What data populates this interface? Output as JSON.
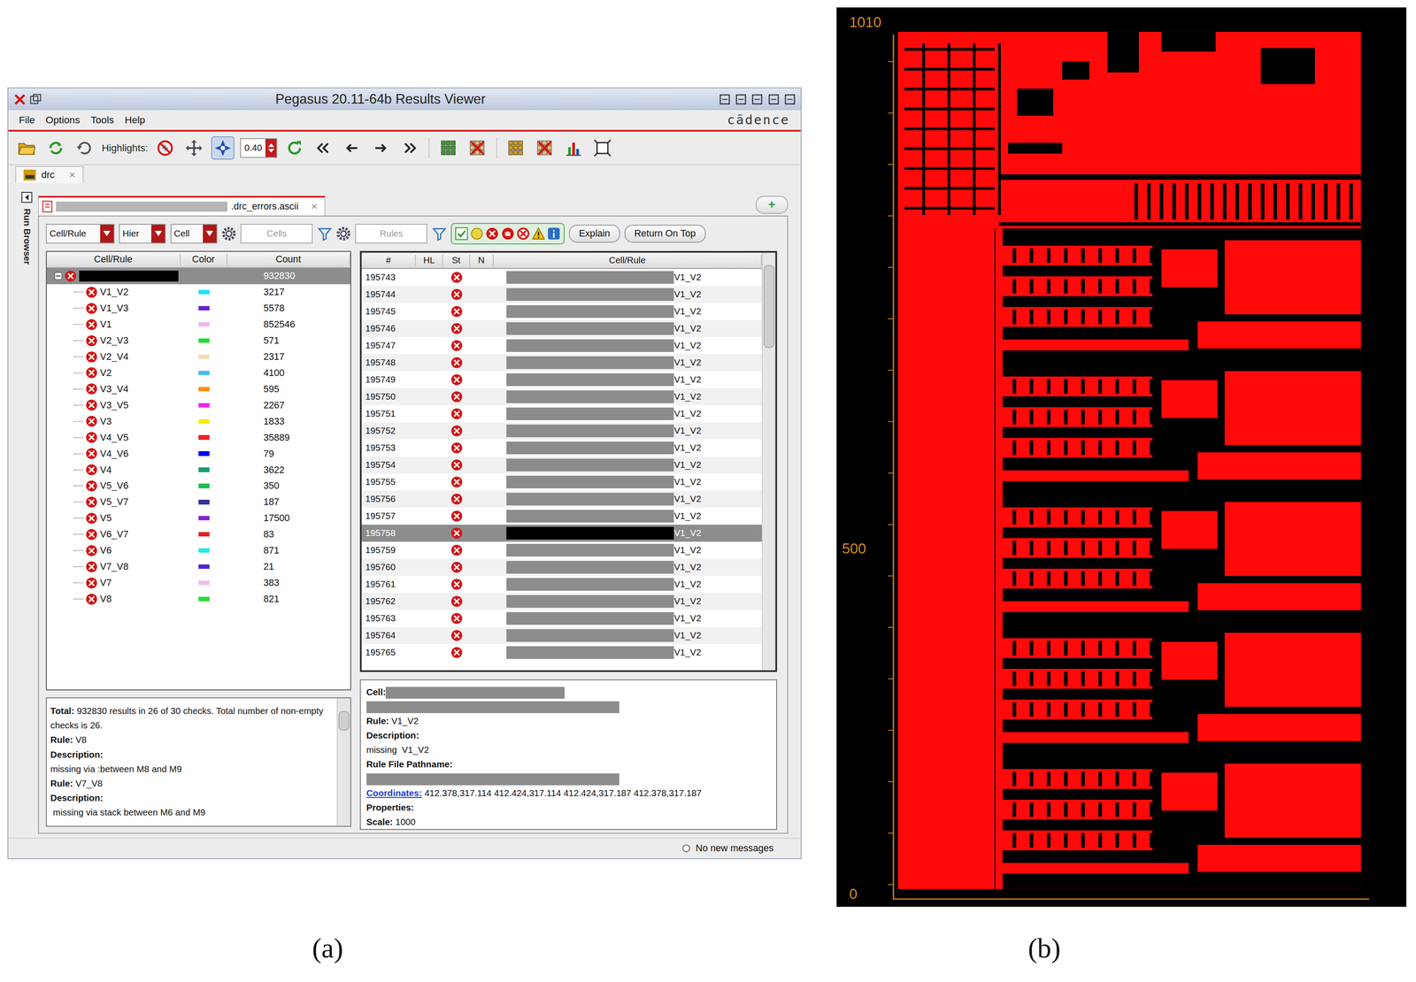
{
  "window": {
    "title": "Pegasus 20.11-64b Results Viewer",
    "logo": "cādence"
  },
  "menu": [
    "File",
    "Options",
    "Tools",
    "Help"
  ],
  "toolbar": {
    "label": "Highlights:",
    "value": "0.40"
  },
  "doc_tabs": [
    {
      "label": "drc",
      "selected": true,
      "close": "×"
    }
  ],
  "sidebar": {
    "label": "Run Browser"
  },
  "results_tab": {
    "label": ".drc_errors.ascii",
    "close": "×",
    "add": "+",
    "selected": true
  },
  "filter_bar": {
    "selects": [
      "Cell/Rule",
      "Hier",
      "Cell"
    ],
    "cells_placeholder": "Cells",
    "rules_placeholder": "Rules",
    "status_filters": [
      {
        "kind": "check"
      },
      {
        "kind": "pending"
      },
      {
        "kind": "error"
      },
      {
        "kind": "waived"
      },
      {
        "kind": "ring"
      },
      {
        "kind": "warning"
      },
      {
        "kind": "info"
      }
    ],
    "buttons": [
      "Explain",
      "Return On Top"
    ]
  },
  "tree": {
    "columns": [
      "Cell/Rule",
      "Color",
      "Count"
    ],
    "root": {
      "count": "932830",
      "selected": true,
      "expanded": true
    },
    "rows": [
      {
        "name": "V1_V2",
        "color": "#22e0ee",
        "count": "3217"
      },
      {
        "name": "V1_V3",
        "color": "#6a1fd0",
        "count": "5578"
      },
      {
        "name": "V1",
        "color": "#f2b4ea",
        "count": "852546"
      },
      {
        "name": "V2_V3",
        "color": "#22dd33",
        "count": "571"
      },
      {
        "name": "V2_V4",
        "color": "#f5dcb0",
        "count": "2317"
      },
      {
        "name": "V2",
        "color": "#44bbf0",
        "count": "4100"
      },
      {
        "name": "V3_V4",
        "color": "#ff8c1a",
        "count": "595"
      },
      {
        "name": "V3_V5",
        "color": "#ee22ee",
        "count": "2267"
      },
      {
        "name": "V3",
        "color": "#f5ee00",
        "count": "1833"
      },
      {
        "name": "V4_V5",
        "color": "#ee2222",
        "count": "35889"
      },
      {
        "name": "V4_V6",
        "color": "#0000ee",
        "count": "79"
      },
      {
        "name": "V4",
        "color": "#1a9a6a",
        "count": "3622"
      },
      {
        "name": "V5_V6",
        "color": "#22bb55",
        "count": "350"
      },
      {
        "name": "V5_V7",
        "color": "#333399",
        "count": "187"
      },
      {
        "name": "V5",
        "color": "#8822cc",
        "count": "17500"
      },
      {
        "name": "V6_V7",
        "color": "#dd2222",
        "count": "83"
      },
      {
        "name": "V6",
        "color": "#22e8ee",
        "count": "871"
      },
      {
        "name": "V7_V8",
        "color": "#5522cc",
        "count": "21"
      },
      {
        "name": "V7",
        "color": "#f5b8ec",
        "count": "383"
      },
      {
        "name": "V8",
        "color": "#22dd33",
        "count": "821"
      }
    ]
  },
  "info": [
    {
      "label": "Total:",
      "value": " 932830 results in 26 of 30 checks. Total number of non-empty checks is 26."
    },
    {
      "label": "Rule:",
      "value": " V8"
    },
    {
      "label": "Description:",
      "value": ""
    },
    {
      "label": "",
      "value": "missing via :between M8 and M9"
    },
    {
      "label": "Rule:",
      "value": " V7_V8"
    },
    {
      "label": "Description:",
      "value": ""
    },
    {
      "label": "",
      "value": " missing via stack between M6 and M9"
    }
  ],
  "table": {
    "columns": [
      "#",
      "HL",
      "St",
      "N",
      "Cell/Rule"
    ],
    "rows": [
      {
        "id": "195743",
        "rule": "V1_V2",
        "selected": false
      },
      {
        "id": "195744",
        "rule": "V1_V2",
        "selected": false
      },
      {
        "id": "195745",
        "rule": "V1_V2",
        "selected": false
      },
      {
        "id": "195746",
        "rule": "V1_V2",
        "selected": false
      },
      {
        "id": "195747",
        "rule": "V1_V2",
        "selected": false
      },
      {
        "id": "195748",
        "rule": "V1_V2",
        "selected": false
      },
      {
        "id": "195749",
        "rule": "V1_V2",
        "selected": false
      },
      {
        "id": "195750",
        "rule": "V1_V2",
        "selected": false
      },
      {
        "id": "195751",
        "rule": "V1_V2",
        "selected": false
      },
      {
        "id": "195752",
        "rule": "V1_V2",
        "selected": false
      },
      {
        "id": "195753",
        "rule": "V1_V2",
        "selected": false
      },
      {
        "id": "195754",
        "rule": "V1_V2",
        "selected": false
      },
      {
        "id": "195755",
        "rule": "V1_V2",
        "selected": false
      },
      {
        "id": "195756",
        "rule": "V1_V2",
        "selected": false
      },
      {
        "id": "195757",
        "rule": "V1_V2",
        "selected": false
      },
      {
        "id": "195758",
        "rule": "V1_V2",
        "selected": true
      },
      {
        "id": "195759",
        "rule": "V1_V2",
        "selected": false
      },
      {
        "id": "195760",
        "rule": "V1_V2",
        "selected": false
      },
      {
        "id": "195761",
        "rule": "V1_V2",
        "selected": false
      },
      {
        "id": "195762",
        "rule": "V1_V2",
        "selected": false
      },
      {
        "id": "195763",
        "rule": "V1_V2",
        "selected": false
      },
      {
        "id": "195764",
        "rule": "V1_V2",
        "selected": false
      },
      {
        "id": "195765",
        "rule": "V1_V2",
        "selected": false
      }
    ]
  },
  "details": [
    {
      "kind": "field",
      "label": "Cell:",
      "value": ""
    },
    {
      "kind": "redacted",
      "label": "",
      "value": ""
    },
    {
      "kind": "field",
      "label": "Rule:",
      "value": " V1_V2"
    },
    {
      "kind": "field",
      "label": "Description:",
      "value": ""
    },
    {
      "kind": "text",
      "label": "",
      "value": "missing  V1_V2"
    },
    {
      "kind": "field",
      "label": "Rule File Pathname:",
      "value": ""
    },
    {
      "kind": "redacted",
      "label": "",
      "value": ""
    },
    {
      "kind": "link",
      "label": "Coordinates:",
      "value": " 412.378,317.114 412.424,317.114 412.424,317.187 412.378,317.187"
    },
    {
      "kind": "field",
      "label": "Properties:",
      "value": ""
    },
    {
      "kind": "field",
      "label": "Scale:",
      "value": " 1000"
    }
  ],
  "status_bar": {
    "message": "No new messages"
  },
  "layout_view": {
    "ticks": [
      "1010",
      "500",
      "0"
    ]
  },
  "captions": [
    "(a)",
    "(b)"
  ]
}
